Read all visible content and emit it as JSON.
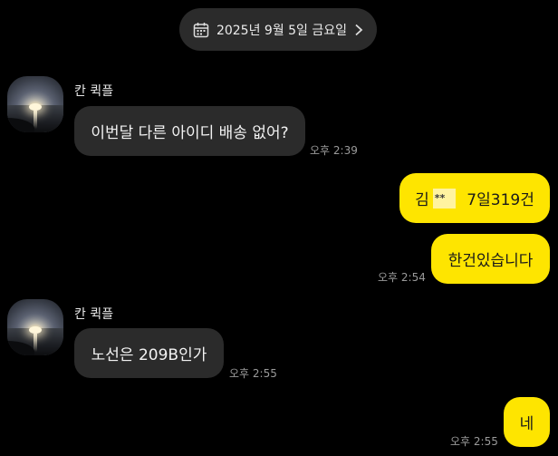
{
  "date_divider": {
    "text": "2025년 9월 5일 금요일"
  },
  "messages": [
    {
      "sender": "칸 퀵플",
      "text": "이번달 다른 아이디 배송 없어?",
      "time": "오후 2:39"
    },
    {
      "name_part": "김",
      "masked": "**",
      "rest": "7일319건"
    },
    {
      "text": "한건있습니다",
      "time": "오후 2:54"
    },
    {
      "sender": "칸 퀵플",
      "text": "노선은 209B인가",
      "time": "오후 2:55"
    },
    {
      "text": "네",
      "time": "오후 2:55"
    }
  ],
  "colors": {
    "background": "#000000",
    "incoming_bubble": "#2b2b2b",
    "outgoing_bubble": "#fee500",
    "timestamp": "#9a9a9a"
  }
}
